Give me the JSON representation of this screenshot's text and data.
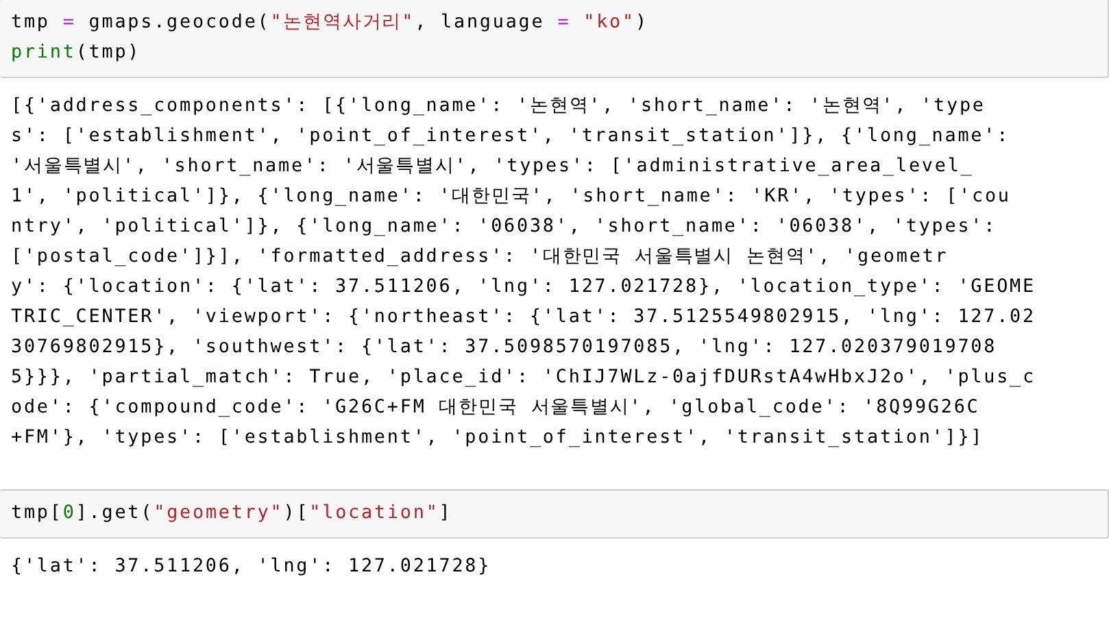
{
  "cells": [
    {
      "input": [
        [
          {
            "kind": "plain",
            "text": "tmp "
          },
          {
            "kind": "operator",
            "text": "="
          },
          {
            "kind": "plain",
            "text": " gmaps.geocode("
          },
          {
            "kind": "string",
            "text": "\"논현역사거리\""
          },
          {
            "kind": "plain",
            "text": ", language "
          },
          {
            "kind": "operator",
            "text": "="
          },
          {
            "kind": "string",
            "text": " \"ko\""
          },
          {
            "kind": "plain",
            "text": ")"
          }
        ],
        [
          {
            "kind": "builtin",
            "text": "print"
          },
          {
            "kind": "plain",
            "text": "(tmp)"
          }
        ]
      ],
      "output": [
        "[{'address_components': [{'long_name': '논현역', 'short_name': '논현역', 'type",
        "s': ['establishment', 'point_of_interest', 'transit_station']}, {'long_name':",
        "'서울특별시', 'short_name': '서울특별시', 'types': ['administrative_area_level_",
        "1', 'political']}, {'long_name': '대한민국', 'short_name': 'KR', 'types': ['cou",
        "ntry', 'political']}, {'long_name': '06038', 'short_name': '06038', 'types':",
        "['postal_code']}], 'formatted_address': '대한민국 서울특별시 논현역', 'geometr",
        "y': {'location': {'lat': 37.511206, 'lng': 127.021728}, 'location_type': 'GEOME",
        "TRIC_CENTER', 'viewport': {'northeast': {'lat': 37.5125549802915, 'lng': 127.02",
        "30769802915}, 'southwest': {'lat': 37.5098570197085, 'lng': 127.020379019708",
        "5}}}, 'partial_match': True, 'place_id': 'ChIJ7WLz-0ajfDURstA4wHbxJ2o', 'plus_c",
        "ode': {'compound_code': 'G26C+FM 대한민국 서울특별시', 'global_code': '8Q99G26C",
        "+FM'}, 'types': ['establishment', 'point_of_interest', 'transit_station']}]"
      ]
    },
    {
      "input": [
        [
          {
            "kind": "plain",
            "text": "tmp["
          },
          {
            "kind": "number",
            "text": "0"
          },
          {
            "kind": "plain",
            "text": "].get("
          },
          {
            "kind": "string",
            "text": "\"geometry\""
          },
          {
            "kind": "plain",
            "text": ")["
          },
          {
            "kind": "string",
            "text": "\"location\""
          },
          {
            "kind": "plain",
            "text": "]"
          }
        ]
      ],
      "output": [
        "{'lat': 37.511206, 'lng': 127.021728}"
      ]
    }
  ]
}
